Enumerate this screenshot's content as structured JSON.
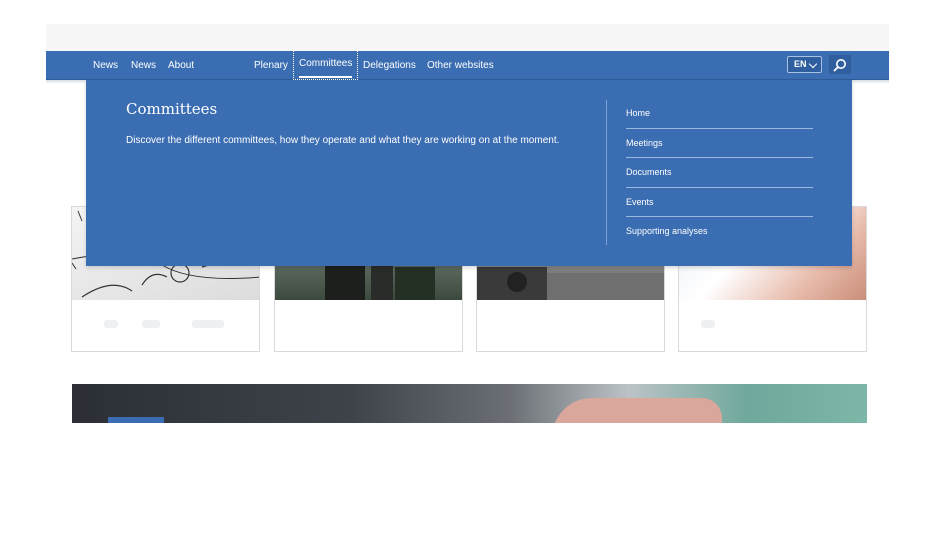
{
  "nav": {
    "items": [
      {
        "label": "News"
      },
      {
        "label": "News"
      },
      {
        "label": "About"
      },
      {
        "label": "Plenary"
      },
      {
        "label": "Committees"
      },
      {
        "label": "Delegations"
      },
      {
        "label": "Other websites"
      }
    ],
    "language": "EN"
  },
  "mega_menu": {
    "title": "Committees",
    "description": "Discover the different committees, how they operate and what they are working on at the moment.",
    "links": [
      {
        "label": "Home"
      },
      {
        "label": "Meetings"
      },
      {
        "label": "Documents"
      },
      {
        "label": "Events"
      },
      {
        "label": "Supporting analyses"
      }
    ]
  },
  "colors": {
    "nav_blue": "#3a6db1",
    "white": "#ffffff"
  },
  "icons": {
    "search": "search-icon",
    "language_chevron": "chevron-down-icon"
  }
}
